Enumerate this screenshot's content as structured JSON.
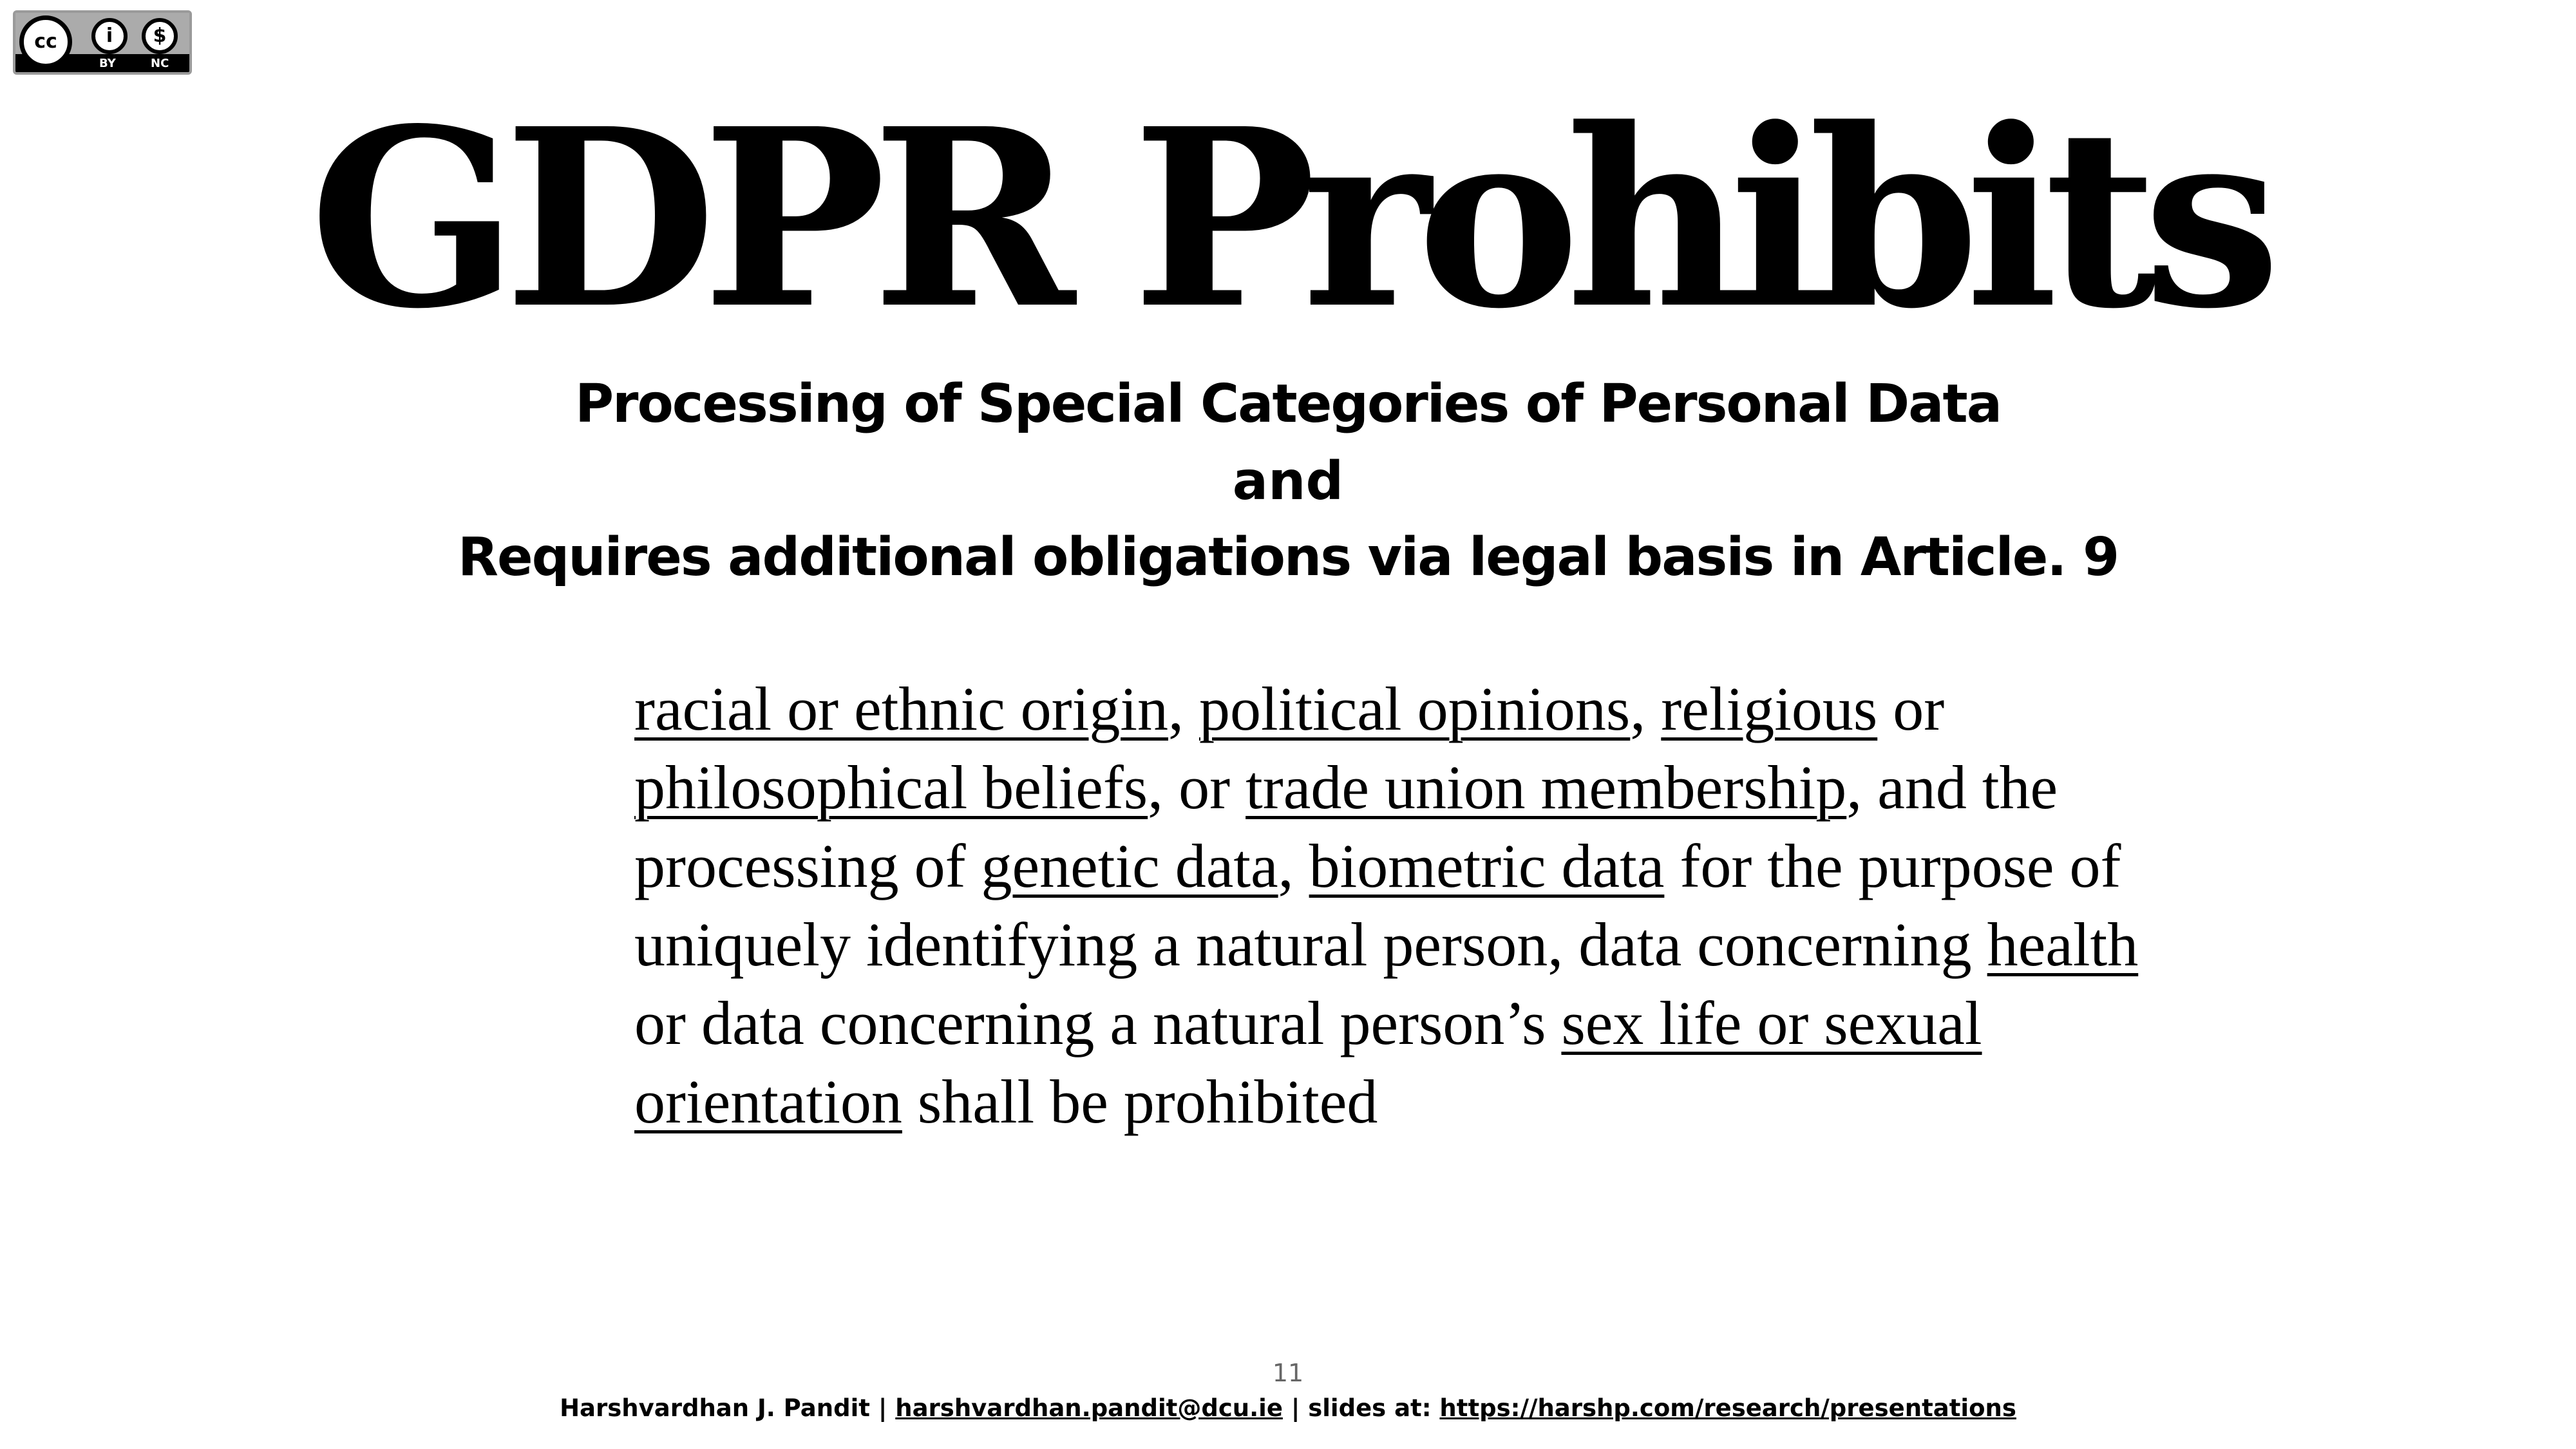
{
  "license": {
    "by": "BY",
    "nc": "NC",
    "icon": "cc-icon"
  },
  "title": "GDPR Prohibits",
  "subtitle": {
    "line1": "Processing of Special Categories of Personal Data",
    "line2": "and",
    "line3": "Requires additional obligations via legal basis in Article. 9"
  },
  "body": {
    "s1": "racial or ethnic origin",
    "s2": ", ",
    "s3": "political opinions",
    "s4": ", ",
    "s5": "religious",
    "s6": " or ",
    "s7": "philosophical beliefs",
    "s8": ", or ",
    "s9": "trade union membership",
    "s10": ", and the processing of ",
    "s11": "genetic data",
    "s12": ", ",
    "s13": "biometric data",
    "s14": " for the purpose of uniquely identifying a natural person, data concerning ",
    "s15": "health",
    "s16": " or data concerning a natural person’s ",
    "s17": "sex life or sexual orientation",
    "s18": " shall be prohibited"
  },
  "page_number": "11",
  "footer": {
    "author": "Harshvardhan J. Pandit | ",
    "email": "harshvardhan.pandit@dcu.ie",
    "sep": " | slides at: ",
    "url": "https://harshp.com/research/presentations"
  }
}
